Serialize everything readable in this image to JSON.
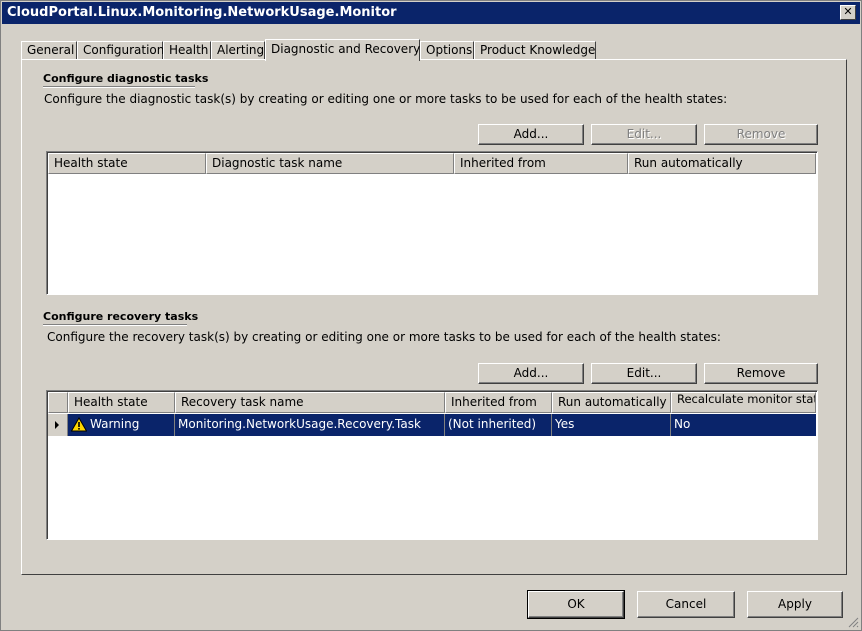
{
  "window": {
    "title": "CloudPortal.Linux.Monitoring.NetworkUsage.Monitor",
    "close_glyph": "✕"
  },
  "tabs": [
    {
      "label": "General"
    },
    {
      "label": "Configuration"
    },
    {
      "label": "Health"
    },
    {
      "label": "Alerting"
    },
    {
      "label": "Diagnostic and Recovery",
      "active": true
    },
    {
      "label": "Options"
    },
    {
      "label": "Product Knowledge"
    }
  ],
  "diagnostic": {
    "title": "Configure diagnostic tasks",
    "description": "Configure the diagnostic task(s) by creating or editing one or more tasks to be used for each of the health states:",
    "add_label": "Add...",
    "edit_label": "Edit...",
    "remove_label": "Remove",
    "columns": [
      "Health state",
      "Diagnostic task name",
      "Inherited from",
      "Run automatically"
    ]
  },
  "recovery": {
    "title": "Configure recovery tasks",
    "description": "Configure the recovery task(s) by creating or editing one or more tasks to be used for each of the health states:",
    "add_label": "Add...",
    "edit_label": "Edit...",
    "remove_label": "Remove",
    "columns": [
      "Health state",
      "Recovery task name",
      "Inherited from",
      "Run automatically",
      "Recalculate monitor state"
    ],
    "rows": [
      {
        "health_state": "Warning",
        "task_name": "Monitoring.NetworkUsage.Recovery.Task",
        "inherited_from": "(Not inherited)",
        "run_automatically": "Yes",
        "recalculate": "No"
      }
    ]
  },
  "footer": {
    "ok_label": "OK",
    "cancel_label": "Cancel",
    "apply_label": "Apply"
  },
  "colors": {
    "titlebar": "#0a246a",
    "selection": "#0a246a",
    "face": "#d4d0c8"
  }
}
